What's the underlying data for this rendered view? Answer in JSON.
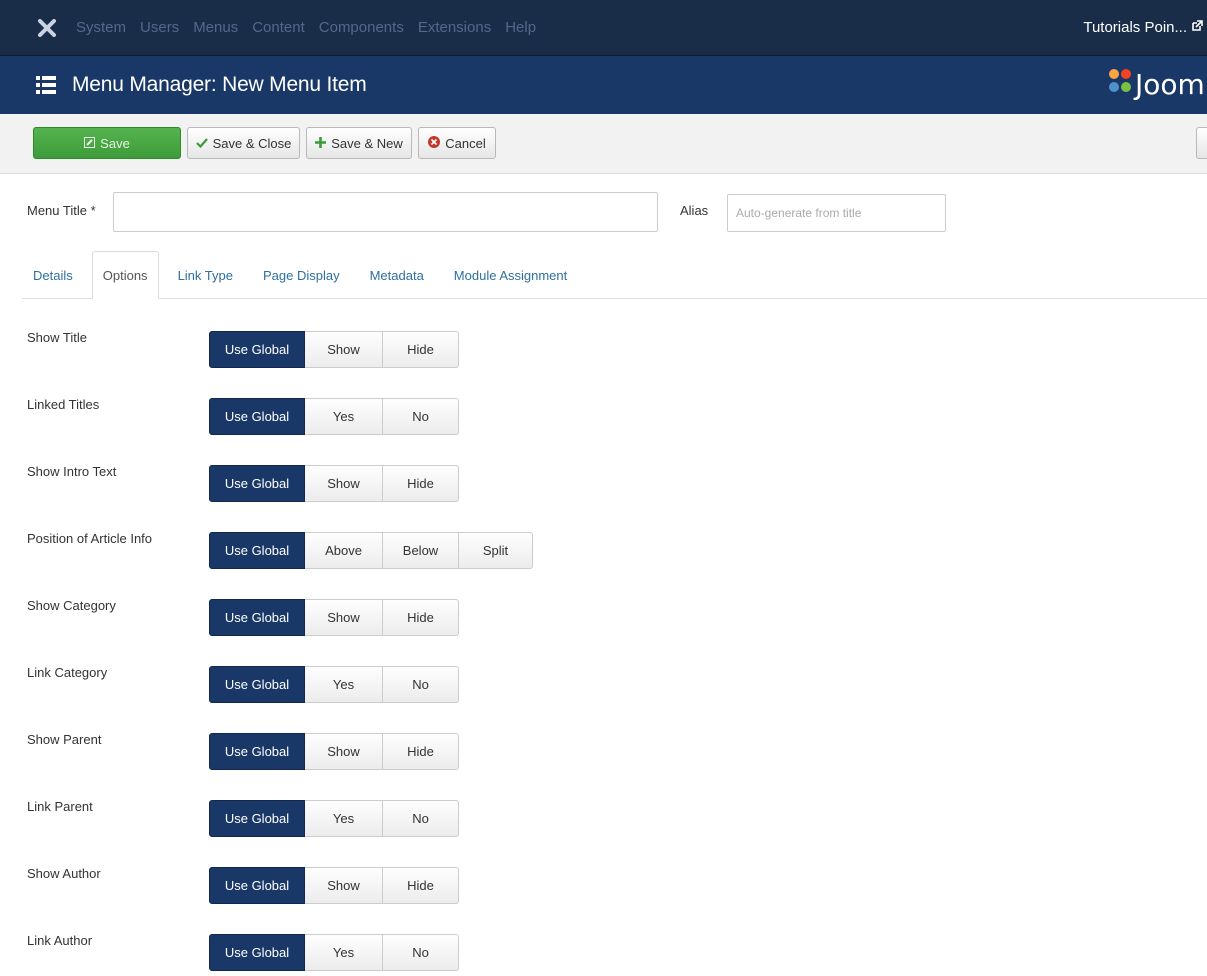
{
  "topnav": {
    "menu": [
      "System",
      "Users",
      "Menus",
      "Content",
      "Components",
      "Extensions",
      "Help"
    ],
    "site_name": "Tutorials Poin..."
  },
  "subhead": {
    "title": "Menu Manager: New Menu Item",
    "brand": "Joom"
  },
  "toolbar": {
    "save": "Save",
    "save_close": "Save & Close",
    "save_new": "Save & New",
    "cancel": "Cancel"
  },
  "form": {
    "menu_title_label": "Menu Title *",
    "menu_title_value": "",
    "alias_label": "Alias",
    "alias_placeholder": "Auto-generate from title"
  },
  "tabs": [
    "Details",
    "Options",
    "Link Type",
    "Page Display",
    "Metadata",
    "Module Assignment"
  ],
  "active_tab": "Options",
  "options": [
    {
      "label": "Show Title",
      "choices": [
        "Use Global",
        "Show",
        "Hide"
      ],
      "selected": "Use Global"
    },
    {
      "label": "Linked Titles",
      "choices": [
        "Use Global",
        "Yes",
        "No"
      ],
      "selected": "Use Global"
    },
    {
      "label": "Show Intro Text",
      "choices": [
        "Use Global",
        "Show",
        "Hide"
      ],
      "selected": "Use Global"
    },
    {
      "label": "Position of Article Info",
      "choices": [
        "Use Global",
        "Above",
        "Below",
        "Split"
      ],
      "selected": "Use Global"
    },
    {
      "label": "Show Category",
      "choices": [
        "Use Global",
        "Show",
        "Hide"
      ],
      "selected": "Use Global"
    },
    {
      "label": "Link Category",
      "choices": [
        "Use Global",
        "Yes",
        "No"
      ],
      "selected": "Use Global"
    },
    {
      "label": "Show Parent",
      "choices": [
        "Use Global",
        "Show",
        "Hide"
      ],
      "selected": "Use Global"
    },
    {
      "label": "Link Parent",
      "choices": [
        "Use Global",
        "Yes",
        "No"
      ],
      "selected": "Use Global"
    },
    {
      "label": "Show Author",
      "choices": [
        "Use Global",
        "Show",
        "Hide"
      ],
      "selected": "Use Global"
    },
    {
      "label": "Link Author",
      "choices": [
        "Use Global",
        "Yes",
        "No"
      ],
      "selected": "Use Global"
    }
  ],
  "colors": {
    "topnav_bg": "#192c48",
    "subhead_bg": "#1a3867",
    "save_green": "#46a546",
    "active_segment": "#1a3867",
    "tab_link": "#2f6f9f"
  }
}
